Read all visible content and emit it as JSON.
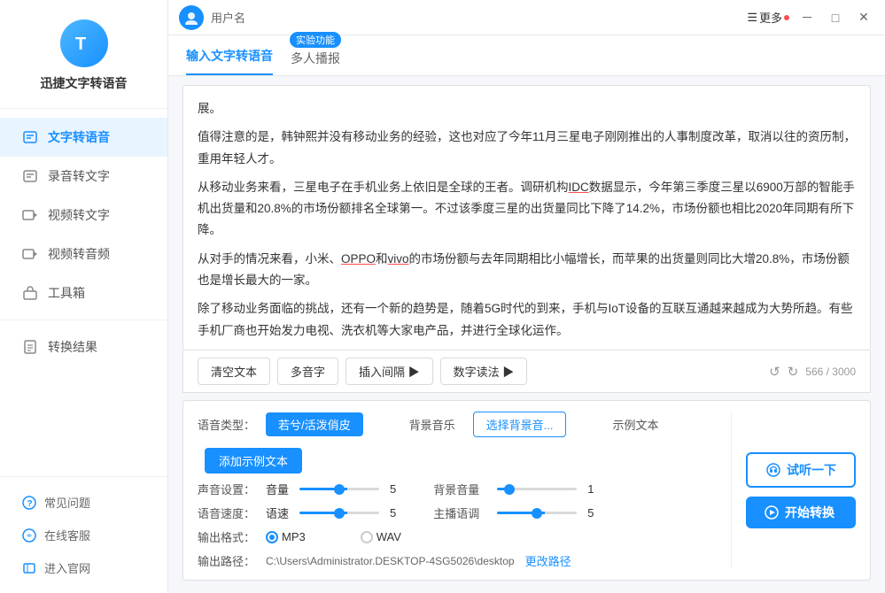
{
  "app": {
    "title": "迅捷文字转语音",
    "logo_letter": "T"
  },
  "sidebar": {
    "nav_items": [
      {
        "id": "text-to-speech",
        "label": "文字转语音",
        "active": true
      },
      {
        "id": "recording-to-text",
        "label": "录音转文字",
        "active": false
      },
      {
        "id": "video-to-text",
        "label": "视频转文字",
        "active": false
      },
      {
        "id": "video-to-audio",
        "label": "视频转音频",
        "active": false
      },
      {
        "id": "toolbox",
        "label": "工具箱",
        "active": false
      }
    ],
    "other_items": [
      {
        "id": "conversion-result",
        "label": "转换结果"
      }
    ],
    "footer_items": [
      {
        "id": "faq",
        "label": "常见问题"
      },
      {
        "id": "online-service",
        "label": "在线客服"
      },
      {
        "id": "official-website",
        "label": "进入官网"
      }
    ]
  },
  "titlebar": {
    "username": "用户名",
    "more_label": "更多",
    "buttons": [
      "minimize",
      "maximize",
      "close"
    ]
  },
  "tabs": [
    {
      "id": "text-input",
      "label": "输入文字转语音",
      "active": true,
      "badge": null
    },
    {
      "id": "multi-broadcast",
      "label": "多人播报",
      "active": false,
      "badge": "实验功能"
    }
  ],
  "editor": {
    "content": "展。\n\n值得注意的是，韩钟熙并没有移动业务的经验，这也对应了今年11月三星电子刚刚推出的人事制度改革，取消以往的资历制，重用年轻人才。\n\n从移动业务来看，三星电子在手机业务上依旧是全球的王者。调研机构IDC数据显示，今年第三季度三星以6900万部的智能手机出货量和20.8%的市场份额排名全球第一。不过该季度三星的出货量同比下降了14.2%，市场份额也相比2020年同期有所下降。\n\n从对手的情况来看，小米、OPPO和vivo的市场份额与去年同期相比小幅增长，而苹果的出货量则同比大增20.8%，市场份额也是增长最大的一家。\n\n除了移动业务面临的挑战，还有一个新的趋势是，随着5G时代的到来，手机与IoT设备的互联互通越来越成为大势所趋。有些手机厂商也开始发力电视、洗衣机等大家电产品，并进行全球化运作。"
  },
  "toolbar": {
    "clear_btn": "清空文本",
    "polyphonic_btn": "多音字",
    "insert_pause_btn": "插入间隔 ▶",
    "number_reading_btn": "数字读法 ▶",
    "char_count": "566 / 3000"
  },
  "settings": {
    "voice_type_label": "语音类型：",
    "voice_type_value": "若兮/活泼俏皮",
    "bg_music_label": "背景音乐",
    "bg_music_btn": "选择背景音...",
    "example_text_label": "示例文本",
    "add_example_btn": "添加示例文本",
    "volume_label": "声音设置：",
    "volume_sub": "音量",
    "volume_value": "5",
    "bg_volume_label": "背景音量",
    "bg_volume_value": "1",
    "speed_label": "语音速度：",
    "speed_sub": "语速",
    "speed_value": "5",
    "pitch_label": "主播语调",
    "pitch_value": "5",
    "format_label": "输出格式：",
    "format_mp3": "MP3",
    "format_wav": "WAV",
    "path_label": "输出路径：",
    "path_value": "C:\\Users\\Administrator.DESKTOP-4SG5026\\desktop",
    "change_path_btn": "更改路径",
    "listen_btn": "试听一下",
    "convert_btn": "开始转换"
  }
}
